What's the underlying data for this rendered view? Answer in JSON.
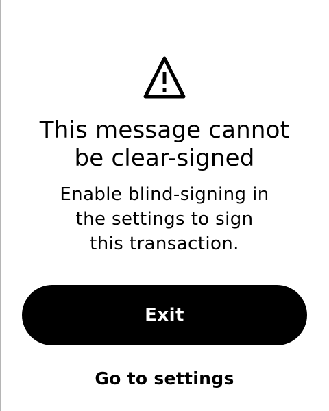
{
  "warning": {
    "icon": "warning-triangle-icon"
  },
  "message": {
    "title_lines": [
      "This message cannot",
      "be clear-signed"
    ],
    "description_lines": [
      "Enable blind-signing in",
      "the settings to sign",
      "this transaction."
    ]
  },
  "actions": {
    "exit_label": "Exit",
    "settings_label": "Go to settings"
  },
  "colors": {
    "background": "#ffffff",
    "foreground": "#000000",
    "button_text": "#ffffff"
  }
}
